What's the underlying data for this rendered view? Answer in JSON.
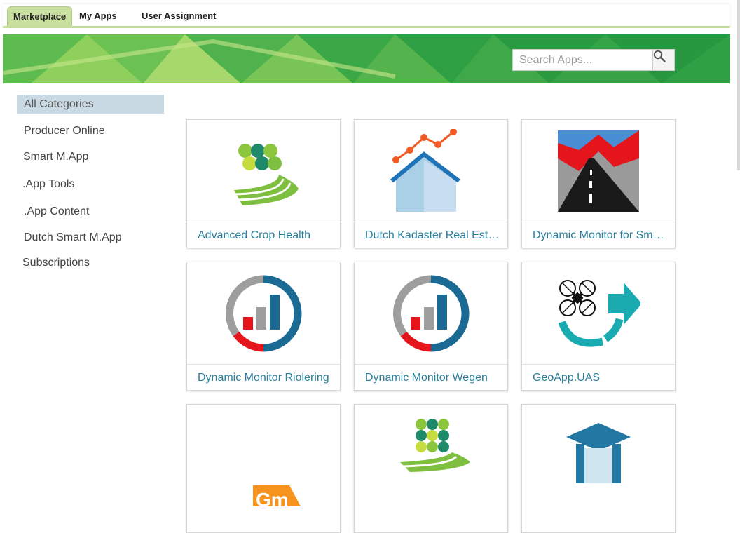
{
  "tabs": [
    {
      "label": "Marketplace",
      "active": true
    },
    {
      "label": "My Apps",
      "active": false
    },
    {
      "label": "User Assignment",
      "active": false
    }
  ],
  "search": {
    "placeholder": "Search Apps..."
  },
  "categories": [
    {
      "label": "All Categories",
      "active": true
    },
    {
      "label": "Producer Online"
    },
    {
      "label": "Smart M.App"
    },
    {
      "label": ".App Tools"
    },
    {
      "label": ".App Content"
    },
    {
      "label": "Dutch Smart M.App"
    },
    {
      "label": "Subscriptions"
    }
  ],
  "apps": [
    {
      "title": "Advanced Crop Health",
      "icon": "crop-health-icon"
    },
    {
      "title": "Dutch Kadaster Real Estate",
      "icon": "real-estate-icon"
    },
    {
      "title": "Dynamic Monitor for Smart M.App",
      "icon": "road-monitor-icon"
    },
    {
      "title": "Dynamic Monitor Riolering",
      "icon": "gauge-chart-icon"
    },
    {
      "title": "Dynamic Monitor Wegen",
      "icon": "gauge-chart-icon"
    },
    {
      "title": "GeoApp.UAS",
      "icon": "drone-icon"
    },
    {
      "title": "",
      "icon": "gm-logo-icon"
    },
    {
      "title": "",
      "icon": "crop-health-icon"
    },
    {
      "title": "",
      "icon": "graduation-cap-icon"
    }
  ],
  "icon_text": {
    "gm": "Gm"
  },
  "colors": {
    "brand_green": "#2ea84a",
    "tab_active": "#c8dfa0",
    "link": "#2a7f9c",
    "category_active": "#c9d9e3"
  }
}
